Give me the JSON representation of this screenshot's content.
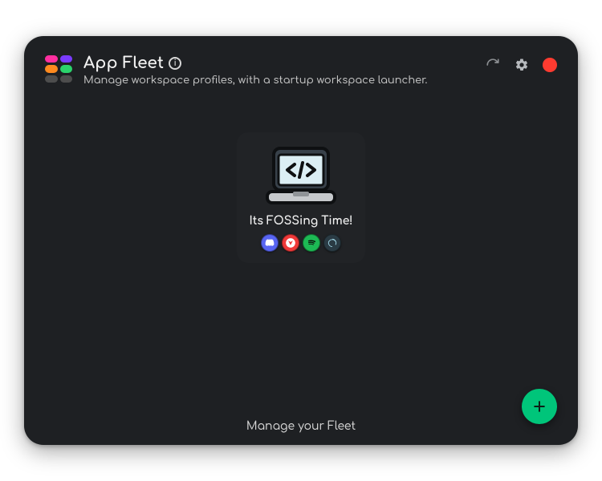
{
  "header": {
    "title": "App Fleet",
    "subtitle": "Manage workspace profiles, with a startup workspace launcher.",
    "info_glyph": "i",
    "logo_colors": [
      "#ff2fa0",
      "#7a3bff",
      "#ff8a1f",
      "#2bd36b",
      "#4d4d4d",
      "#4d4d4d"
    ],
    "actions": {
      "refresh": "refresh-icon",
      "settings": "gear-icon",
      "close": "close-dot",
      "close_color": "#ff3b30"
    }
  },
  "workspaces": [
    {
      "name": "Its FOSSing Time!",
      "icon": "laptop-code-icon",
      "apps": [
        {
          "name": "Discord",
          "icon": "discord-icon",
          "bg": "#5865F2",
          "fg": "#ffffff"
        },
        {
          "name": "Vivaldi",
          "icon": "vivaldi-icon",
          "bg": "#ef3939",
          "fg": "#ffffff"
        },
        {
          "name": "Spotify",
          "icon": "spotify-icon",
          "bg": "#1DB954",
          "fg": "#0b0b0b"
        },
        {
          "name": "OBS",
          "icon": "obs-icon",
          "bg": "#2a3b44",
          "fg": "#9fd6e6"
        }
      ]
    }
  ],
  "footer": {
    "label": "Manage your Fleet"
  },
  "fab": {
    "label": "Add workspace",
    "color": "#00c57a"
  }
}
